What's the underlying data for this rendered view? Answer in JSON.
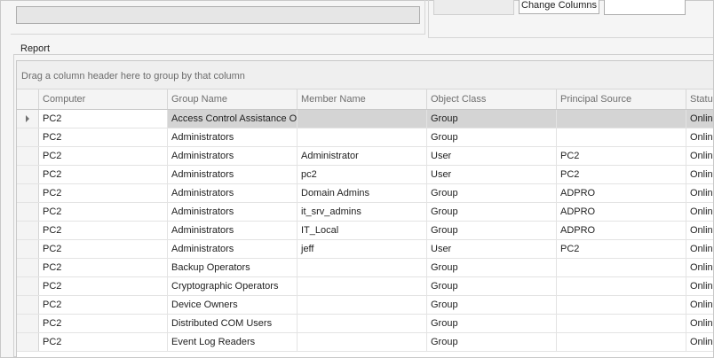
{
  "toolbar": {
    "change_columns_label": "Change Columns",
    "search_value": ""
  },
  "report": {
    "title": "Report",
    "group_hint": "Drag a column header here to group by that column",
    "columns": [
      "Computer",
      "Group Name",
      "Member Name",
      "Object Class",
      "Principal Source",
      "Status"
    ],
    "rows": [
      {
        "computer": "PC2",
        "group": "Access Control Assistance Operators",
        "member": "",
        "object_class": "Group",
        "source": "",
        "status": "Online",
        "selected": true
      },
      {
        "computer": "PC2",
        "group": "Administrators",
        "member": "",
        "object_class": "Group",
        "source": "",
        "status": "Online"
      },
      {
        "computer": "PC2",
        "group": "Administrators",
        "member": "Administrator",
        "object_class": "User",
        "source": "PC2",
        "status": "Online"
      },
      {
        "computer": "PC2",
        "group": "Administrators",
        "member": "pc2",
        "object_class": "User",
        "source": "PC2",
        "status": "Online"
      },
      {
        "computer": "PC2",
        "group": "Administrators",
        "member": "Domain Admins",
        "object_class": "Group",
        "source": "ADPRO",
        "status": "Online"
      },
      {
        "computer": "PC2",
        "group": "Administrators",
        "member": "it_srv_admins",
        "object_class": "Group",
        "source": "ADPRO",
        "status": "Online"
      },
      {
        "computer": "PC2",
        "group": "Administrators",
        "member": "IT_Local",
        "object_class": "Group",
        "source": "ADPRO",
        "status": "Online"
      },
      {
        "computer": "PC2",
        "group": "Administrators",
        "member": "jeff",
        "object_class": "User",
        "source": "PC2",
        "status": "Online"
      },
      {
        "computer": "PC2",
        "group": "Backup Operators",
        "member": "",
        "object_class": "Group",
        "source": "",
        "status": "Online"
      },
      {
        "computer": "PC2",
        "group": "Cryptographic Operators",
        "member": "",
        "object_class": "Group",
        "source": "",
        "status": "Online"
      },
      {
        "computer": "PC2",
        "group": "Device Owners",
        "member": "",
        "object_class": "Group",
        "source": "",
        "status": "Online"
      },
      {
        "computer": "PC2",
        "group": "Distributed COM Users",
        "member": "",
        "object_class": "Group",
        "source": "",
        "status": "Online"
      },
      {
        "computer": "PC2",
        "group": "Event Log Readers",
        "member": "",
        "object_class": "Group",
        "source": "",
        "status": "Online"
      }
    ]
  },
  "icons": {
    "row_indicator": "current-row-arrow-icon"
  },
  "colors": {
    "selected_row": "#d4d4d4",
    "header_bg": "#f4f4f4"
  }
}
